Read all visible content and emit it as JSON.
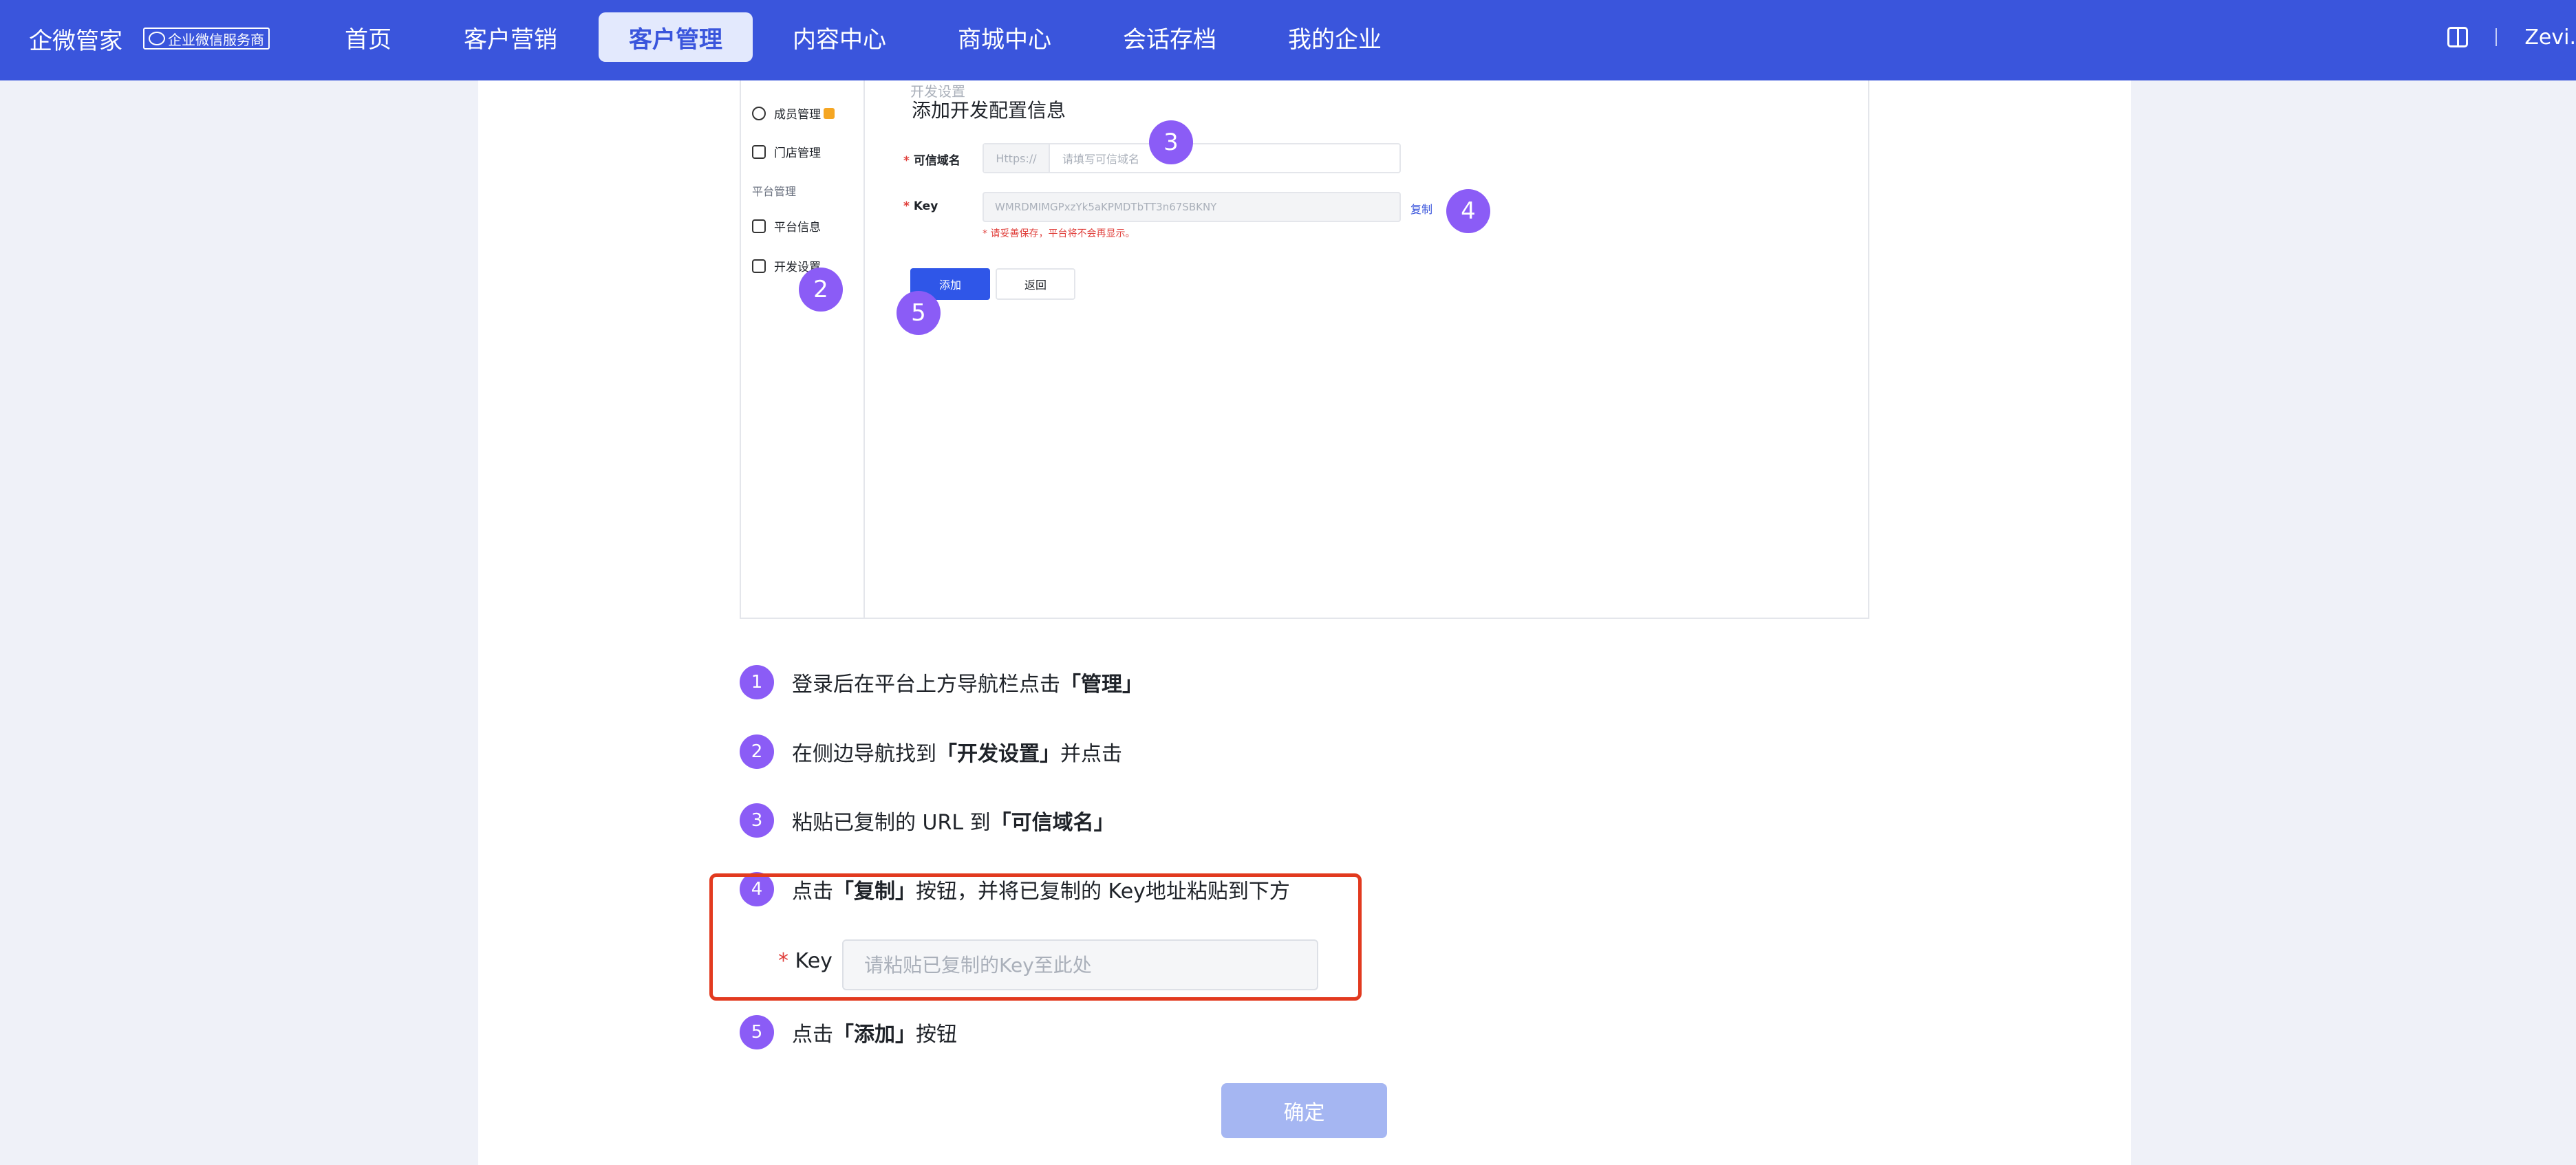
{
  "brand": {
    "name": "企微管家",
    "badge": "企业微信服务商"
  },
  "nav": {
    "items": [
      {
        "label": "首页"
      },
      {
        "label": "客户营销"
      },
      {
        "label": "客户管理",
        "active": true
      },
      {
        "label": "内容中心"
      },
      {
        "label": "商城中心"
      },
      {
        "label": "会话存档"
      },
      {
        "label": "我的企业"
      }
    ],
    "user": "Zevi.",
    "book_icon": "book-icon"
  },
  "shot": {
    "crumb": "开发设置",
    "side": {
      "member": "成员管理",
      "store": "门店管理",
      "group": "平台管理",
      "platform": "平台信息",
      "dev": "开发设置"
    },
    "title": "添加开发配置信息",
    "required_mark": "*",
    "domain_label": "可信域名",
    "domain_prefix": "Https://",
    "domain_placeholder": "请填写可信域名",
    "key_label": "Key",
    "key_value": "WMRDMIMGPxzYk5aKPMDTbTT3n67SBKNY",
    "copy": "复制",
    "warn": "* 请妥善保存，平台将不会再显示。",
    "add": "添加",
    "back": "返回",
    "markers": [
      "2",
      "3",
      "4",
      "5"
    ]
  },
  "steps": [
    {
      "num": "1",
      "pre": "登录后在平台上方导航栏点击",
      "bold": "「管理」",
      "post": ""
    },
    {
      "num": "2",
      "pre": "在侧边导航找到",
      "bold": "「开发设置」",
      "post": "并点击"
    },
    {
      "num": "3",
      "pre": "粘贴已复制的 URL 到",
      "bold": "「可信域名」",
      "post": ""
    },
    {
      "num": "4",
      "pre": "点击",
      "bold": "「复制」",
      "post": "按钮，并将已复制的 Key地址粘贴到下方"
    },
    {
      "num": "5",
      "pre": "点击",
      "bold": "「添加」",
      "post": "按钮"
    }
  ],
  "key_field": {
    "required_mark": "*",
    "label": "Key",
    "placeholder": "请粘贴已复制的Key至此处"
  },
  "confirm": "确定",
  "colors": {
    "topbar": "#3a55dc",
    "marker": "#8b5cf6",
    "highlight": "#e23a1f",
    "confirm": "#a5b6f2"
  }
}
